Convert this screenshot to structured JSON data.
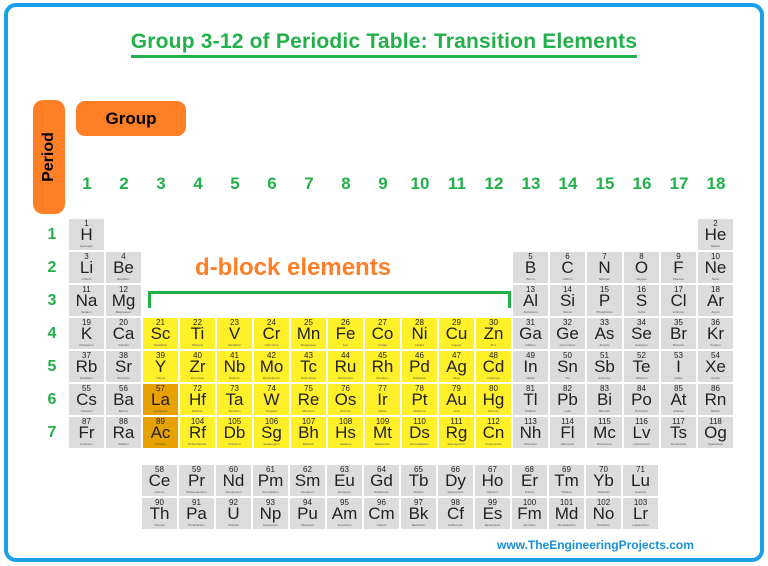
{
  "title": "Group 3-12 of Periodic Table: Transition Elements",
  "labels": {
    "period": "Period",
    "group": "Group",
    "dblock": "d-block elements"
  },
  "footer": "www.TheEngineeringProjects.com",
  "colors": {
    "border": "#1aa0e8",
    "green": "#22b04b",
    "orange": "#ff7f27",
    "d_block": "#fff02a",
    "lanthanide_actinide_marker": "#e8a200",
    "other": "#dcdcdc"
  },
  "groups": [
    "1",
    "2",
    "3",
    "4",
    "5",
    "6",
    "7",
    "8",
    "9",
    "10",
    "11",
    "12",
    "13",
    "14",
    "15",
    "16",
    "17",
    "18"
  ],
  "periods": [
    "1",
    "2",
    "3",
    "4",
    "5",
    "6",
    "7"
  ],
  "elements": [
    {
      "z": "1",
      "s": "H",
      "n": "Hydrogen",
      "g": 1,
      "p": 1,
      "t": "o"
    },
    {
      "z": "2",
      "s": "He",
      "n": "Helium",
      "g": 18,
      "p": 1,
      "t": "o"
    },
    {
      "z": "3",
      "s": "Li",
      "n": "Lithium",
      "g": 1,
      "p": 2,
      "t": "o"
    },
    {
      "z": "4",
      "s": "Be",
      "n": "Beryllium",
      "g": 2,
      "p": 2,
      "t": "o"
    },
    {
      "z": "5",
      "s": "B",
      "n": "Boron",
      "g": 13,
      "p": 2,
      "t": "o"
    },
    {
      "z": "6",
      "s": "C",
      "n": "Carbon",
      "g": 14,
      "p": 2,
      "t": "o"
    },
    {
      "z": "7",
      "s": "N",
      "n": "Nitrogen",
      "g": 15,
      "p": 2,
      "t": "o"
    },
    {
      "z": "8",
      "s": "O",
      "n": "Oxygen",
      "g": 16,
      "p": 2,
      "t": "o"
    },
    {
      "z": "9",
      "s": "F",
      "n": "Fluorine",
      "g": 17,
      "p": 2,
      "t": "o"
    },
    {
      "z": "10",
      "s": "Ne",
      "n": "Neon",
      "g": 18,
      "p": 2,
      "t": "o"
    },
    {
      "z": "11",
      "s": "Na",
      "n": "Sodium",
      "g": 1,
      "p": 3,
      "t": "o"
    },
    {
      "z": "12",
      "s": "Mg",
      "n": "Magnesium",
      "g": 2,
      "p": 3,
      "t": "o"
    },
    {
      "z": "13",
      "s": "Al",
      "n": "Aluminium",
      "g": 13,
      "p": 3,
      "t": "o"
    },
    {
      "z": "14",
      "s": "Si",
      "n": "Silicon",
      "g": 14,
      "p": 3,
      "t": "o"
    },
    {
      "z": "15",
      "s": "P",
      "n": "Phosphorus",
      "g": 15,
      "p": 3,
      "t": "o"
    },
    {
      "z": "16",
      "s": "S",
      "n": "Sulfur",
      "g": 16,
      "p": 3,
      "t": "o"
    },
    {
      "z": "17",
      "s": "Cl",
      "n": "Chlorine",
      "g": 17,
      "p": 3,
      "t": "o"
    },
    {
      "z": "18",
      "s": "Ar",
      "n": "Argon",
      "g": 18,
      "p": 3,
      "t": "o"
    },
    {
      "z": "19",
      "s": "K",
      "n": "Potassium",
      "g": 1,
      "p": 4,
      "t": "o"
    },
    {
      "z": "20",
      "s": "Ca",
      "n": "Calcium",
      "g": 2,
      "p": 4,
      "t": "o"
    },
    {
      "z": "21",
      "s": "Sc",
      "n": "Scandium",
      "g": 3,
      "p": 4,
      "t": "d"
    },
    {
      "z": "22",
      "s": "Ti",
      "n": "Titanium",
      "g": 4,
      "p": 4,
      "t": "d"
    },
    {
      "z": "23",
      "s": "V",
      "n": "Vanadium",
      "g": 5,
      "p": 4,
      "t": "d"
    },
    {
      "z": "24",
      "s": "Cr",
      "n": "Chromium",
      "g": 6,
      "p": 4,
      "t": "d"
    },
    {
      "z": "25",
      "s": "Mn",
      "n": "Manganese",
      "g": 7,
      "p": 4,
      "t": "d"
    },
    {
      "z": "26",
      "s": "Fe",
      "n": "Iron",
      "g": 8,
      "p": 4,
      "t": "d"
    },
    {
      "z": "27",
      "s": "Co",
      "n": "Cobalt",
      "g": 9,
      "p": 4,
      "t": "d"
    },
    {
      "z": "28",
      "s": "Ni",
      "n": "Nickel",
      "g": 10,
      "p": 4,
      "t": "d"
    },
    {
      "z": "29",
      "s": "Cu",
      "n": "Copper",
      "g": 11,
      "p": 4,
      "t": "d"
    },
    {
      "z": "30",
      "s": "Zn",
      "n": "Zinc",
      "g": 12,
      "p": 4,
      "t": "d"
    },
    {
      "z": "31",
      "s": "Ga",
      "n": "Gallium",
      "g": 13,
      "p": 4,
      "t": "o"
    },
    {
      "z": "32",
      "s": "Ge",
      "n": "Germanium",
      "g": 14,
      "p": 4,
      "t": "o"
    },
    {
      "z": "33",
      "s": "As",
      "n": "Arsenic",
      "g": 15,
      "p": 4,
      "t": "o"
    },
    {
      "z": "34",
      "s": "Se",
      "n": "Selenium",
      "g": 16,
      "p": 4,
      "t": "o"
    },
    {
      "z": "35",
      "s": "Br",
      "n": "Bromine",
      "g": 17,
      "p": 4,
      "t": "o"
    },
    {
      "z": "36",
      "s": "Kr",
      "n": "Krypton",
      "g": 18,
      "p": 4,
      "t": "o"
    },
    {
      "z": "37",
      "s": "Rb",
      "n": "Rubidium",
      "g": 1,
      "p": 5,
      "t": "o"
    },
    {
      "z": "38",
      "s": "Sr",
      "n": "Strontium",
      "g": 2,
      "p": 5,
      "t": "o"
    },
    {
      "z": "39",
      "s": "Y",
      "n": "Yttrium",
      "g": 3,
      "p": 5,
      "t": "d"
    },
    {
      "z": "40",
      "s": "Zr",
      "n": "Zirconium",
      "g": 4,
      "p": 5,
      "t": "d"
    },
    {
      "z": "41",
      "s": "Nb",
      "n": "Niobium",
      "g": 5,
      "p": 5,
      "t": "d"
    },
    {
      "z": "42",
      "s": "Mo",
      "n": "Molybdenum",
      "g": 6,
      "p": 5,
      "t": "d"
    },
    {
      "z": "43",
      "s": "Tc",
      "n": "Technetium",
      "g": 7,
      "p": 5,
      "t": "d"
    },
    {
      "z": "44",
      "s": "Ru",
      "n": "Ruthenium",
      "g": 8,
      "p": 5,
      "t": "d"
    },
    {
      "z": "45",
      "s": "Rh",
      "n": "Rhodium",
      "g": 9,
      "p": 5,
      "t": "d"
    },
    {
      "z": "46",
      "s": "Pd",
      "n": "Palladium",
      "g": 10,
      "p": 5,
      "t": "d"
    },
    {
      "z": "47",
      "s": "Ag",
      "n": "Silver",
      "g": 11,
      "p": 5,
      "t": "d"
    },
    {
      "z": "48",
      "s": "Cd",
      "n": "Cadmium",
      "g": 12,
      "p": 5,
      "t": "d"
    },
    {
      "z": "49",
      "s": "In",
      "n": "Indium",
      "g": 13,
      "p": 5,
      "t": "o"
    },
    {
      "z": "50",
      "s": "Sn",
      "n": "Tin",
      "g": 14,
      "p": 5,
      "t": "o"
    },
    {
      "z": "51",
      "s": "Sb",
      "n": "Antimony",
      "g": 15,
      "p": 5,
      "t": "o"
    },
    {
      "z": "52",
      "s": "Te",
      "n": "Tellurium",
      "g": 16,
      "p": 5,
      "t": "o"
    },
    {
      "z": "53",
      "s": "I",
      "n": "Iodine",
      "g": 17,
      "p": 5,
      "t": "o"
    },
    {
      "z": "54",
      "s": "Xe",
      "n": "Xenon",
      "g": 18,
      "p": 5,
      "t": "o"
    },
    {
      "z": "55",
      "s": "Cs",
      "n": "Caesium",
      "g": 1,
      "p": 6,
      "t": "o"
    },
    {
      "z": "56",
      "s": "Ba",
      "n": "Barium",
      "g": 2,
      "p": 6,
      "t": "o"
    },
    {
      "z": "57",
      "s": "La",
      "n": "Lanthanum",
      "g": 3,
      "p": 6,
      "t": "ln"
    },
    {
      "z": "72",
      "s": "Hf",
      "n": "Hafnium",
      "g": 4,
      "p": 6,
      "t": "d"
    },
    {
      "z": "73",
      "s": "Ta",
      "n": "Tantalum",
      "g": 5,
      "p": 6,
      "t": "d"
    },
    {
      "z": "74",
      "s": "W",
      "n": "Tungsten",
      "g": 6,
      "p": 6,
      "t": "d"
    },
    {
      "z": "75",
      "s": "Re",
      "n": "Rhenium",
      "g": 7,
      "p": 6,
      "t": "d"
    },
    {
      "z": "76",
      "s": "Os",
      "n": "Osmium",
      "g": 8,
      "p": 6,
      "t": "d"
    },
    {
      "z": "77",
      "s": "Ir",
      "n": "Iridium",
      "g": 9,
      "p": 6,
      "t": "d"
    },
    {
      "z": "78",
      "s": "Pt",
      "n": "Platinum",
      "g": 10,
      "p": 6,
      "t": "d"
    },
    {
      "z": "79",
      "s": "Au",
      "n": "Gold",
      "g": 11,
      "p": 6,
      "t": "d"
    },
    {
      "z": "80",
      "s": "Hg",
      "n": "Mercury",
      "g": 12,
      "p": 6,
      "t": "d"
    },
    {
      "z": "81",
      "s": "Tl",
      "n": "Thallium",
      "g": 13,
      "p": 6,
      "t": "o"
    },
    {
      "z": "82",
      "s": "Pb",
      "n": "Lead",
      "g": 14,
      "p": 6,
      "t": "o"
    },
    {
      "z": "83",
      "s": "Bi",
      "n": "Bismuth",
      "g": 15,
      "p": 6,
      "t": "o"
    },
    {
      "z": "84",
      "s": "Po",
      "n": "Polonium",
      "g": 16,
      "p": 6,
      "t": "o"
    },
    {
      "z": "85",
      "s": "At",
      "n": "Astatine",
      "g": 17,
      "p": 6,
      "t": "o"
    },
    {
      "z": "86",
      "s": "Rn",
      "n": "Radon",
      "g": 18,
      "p": 6,
      "t": "o"
    },
    {
      "z": "87",
      "s": "Fr",
      "n": "Francium",
      "g": 1,
      "p": 7,
      "t": "o"
    },
    {
      "z": "88",
      "s": "Ra",
      "n": "Radium",
      "g": 2,
      "p": 7,
      "t": "o"
    },
    {
      "z": "89",
      "s": "Ac",
      "n": "Actinium",
      "g": 3,
      "p": 7,
      "t": "ln"
    },
    {
      "z": "104",
      "s": "Rf",
      "n": "Rutherfordium",
      "g": 4,
      "p": 7,
      "t": "d"
    },
    {
      "z": "105",
      "s": "Db",
      "n": "Dubnium",
      "g": 5,
      "p": 7,
      "t": "d"
    },
    {
      "z": "106",
      "s": "Sg",
      "n": "Seaborgium",
      "g": 6,
      "p": 7,
      "t": "d"
    },
    {
      "z": "107",
      "s": "Bh",
      "n": "Bohrium",
      "g": 7,
      "p": 7,
      "t": "d"
    },
    {
      "z": "108",
      "s": "Hs",
      "n": "Hassium",
      "g": 8,
      "p": 7,
      "t": "d"
    },
    {
      "z": "109",
      "s": "Mt",
      "n": "Meitnerium",
      "g": 9,
      "p": 7,
      "t": "d"
    },
    {
      "z": "110",
      "s": "Ds",
      "n": "Darmstadtium",
      "g": 10,
      "p": 7,
      "t": "d"
    },
    {
      "z": "111",
      "s": "Rg",
      "n": "Roentgenium",
      "g": 11,
      "p": 7,
      "t": "d"
    },
    {
      "z": "112",
      "s": "Cn",
      "n": "Copernicium",
      "g": 12,
      "p": 7,
      "t": "d"
    },
    {
      "z": "113",
      "s": "Nh",
      "n": "Nihonium",
      "g": 13,
      "p": 7,
      "t": "o"
    },
    {
      "z": "114",
      "s": "Fl",
      "n": "Flerovium",
      "g": 14,
      "p": 7,
      "t": "o"
    },
    {
      "z": "115",
      "s": "Mc",
      "n": "Moscovium",
      "g": 15,
      "p": 7,
      "t": "o"
    },
    {
      "z": "116",
      "s": "Lv",
      "n": "Livermorium",
      "g": 16,
      "p": 7,
      "t": "o"
    },
    {
      "z": "117",
      "s": "Ts",
      "n": "Tennessine",
      "g": 17,
      "p": 7,
      "t": "o"
    },
    {
      "z": "118",
      "s": "Og",
      "n": "Oganesson",
      "g": 18,
      "p": 7,
      "t": "o"
    }
  ],
  "f_block": [
    [
      {
        "z": "58",
        "s": "Ce",
        "n": "Cerium"
      },
      {
        "z": "59",
        "s": "Pr",
        "n": "Praseodymium"
      },
      {
        "z": "60",
        "s": "Nd",
        "n": "Neodymium"
      },
      {
        "z": "61",
        "s": "Pm",
        "n": "Promethium"
      },
      {
        "z": "62",
        "s": "Sm",
        "n": "Samarium"
      },
      {
        "z": "63",
        "s": "Eu",
        "n": "Europium"
      },
      {
        "z": "64",
        "s": "Gd",
        "n": "Gadolinium"
      },
      {
        "z": "65",
        "s": "Tb",
        "n": "Terbium"
      },
      {
        "z": "66",
        "s": "Dy",
        "n": "Dysprosium"
      },
      {
        "z": "67",
        "s": "Ho",
        "n": "Holmium"
      },
      {
        "z": "68",
        "s": "Er",
        "n": "Erbium"
      },
      {
        "z": "69",
        "s": "Tm",
        "n": "Thulium"
      },
      {
        "z": "70",
        "s": "Yb",
        "n": "Ytterbium"
      },
      {
        "z": "71",
        "s": "Lu",
        "n": "Lutetium"
      }
    ],
    [
      {
        "z": "90",
        "s": "Th",
        "n": "Thorium"
      },
      {
        "z": "91",
        "s": "Pa",
        "n": "Protactinium"
      },
      {
        "z": "92",
        "s": "U",
        "n": "Uranium"
      },
      {
        "z": "93",
        "s": "Np",
        "n": "Neptunium"
      },
      {
        "z": "94",
        "s": "Pu",
        "n": "Plutonium"
      },
      {
        "z": "95",
        "s": "Am",
        "n": "Americium"
      },
      {
        "z": "96",
        "s": "Cm",
        "n": "Curium"
      },
      {
        "z": "97",
        "s": "Bk",
        "n": "Berkelium"
      },
      {
        "z": "98",
        "s": "Cf",
        "n": "Californium"
      },
      {
        "z": "99",
        "s": "Es",
        "n": "Einsteinium"
      },
      {
        "z": "100",
        "s": "Fm",
        "n": "Fermium"
      },
      {
        "z": "101",
        "s": "Md",
        "n": "Mendelevium"
      },
      {
        "z": "102",
        "s": "No",
        "n": "Nobelium"
      },
      {
        "z": "103",
        "s": "Lr",
        "n": "Lawrencium"
      }
    ]
  ]
}
